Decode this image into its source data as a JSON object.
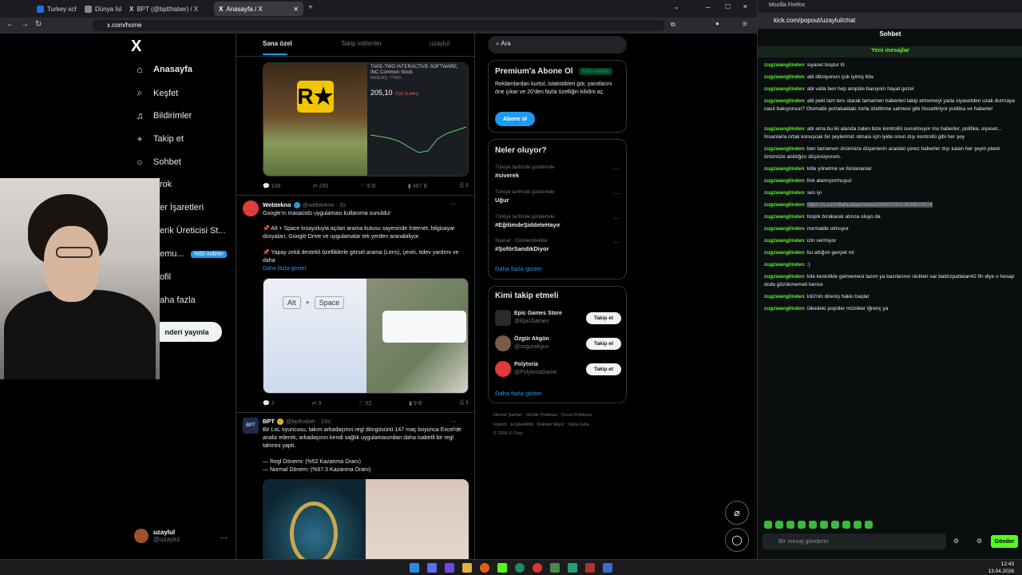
{
  "browser": {
    "tabs": [
      {
        "label": "Turkey scho"
      },
      {
        "label": "Dünya İslerı"
      },
      {
        "label": "BPT (@bptthaber) / X"
      },
      {
        "label": "Anasayfa / X"
      }
    ],
    "url": "x.com/home",
    "new_tab": "+"
  },
  "nav": {
    "items": [
      {
        "label": "Anasayfa",
        "icon": "home-icon"
      },
      {
        "label": "Keşfet",
        "icon": "search-icon"
      },
      {
        "label": "Bildirimler",
        "icon": "bell-icon"
      },
      {
        "label": "Takip et",
        "icon": "follow-icon"
      },
      {
        "label": "Sohbet",
        "icon": "chat-icon"
      },
      {
        "label": "rok",
        "icon": "grok-icon"
      },
      {
        "label": "er İşaretleri",
        "icon": "bookmark-icon"
      },
      {
        "label": "erik Üreticisi St...",
        "icon": "creator-icon"
      },
      {
        "label": "emu...",
        "icon": "premium-icon"
      },
      {
        "label": "ofil",
        "icon": "profile-icon"
      },
      {
        "label": "aha fazla",
        "icon": "more-icon"
      }
    ],
    "premium_badge": "%50 indirim",
    "post_button": "nderi yayınla",
    "me": {
      "name": "uzaylul",
      "handle": "@uzaylul"
    }
  },
  "feed": {
    "tabs": [
      "Sana özel",
      "Takip edilenler",
      "uzaylul"
    ],
    "post1": {
      "img_title": "TAKE-TWO INTERACTIVE SOFTWARE, INC Common Stock",
      "img_ticker": "NASDAQ: TTWO",
      "img_price": "205,10",
      "img_change": "-2,92 (1,44%)",
      "stats": [
        "108",
        "290",
        "6 B",
        "487 B"
      ]
    },
    "post2": {
      "name": "Webtekno",
      "handle": "@webtekno · 2s",
      "lines": [
        "Google'ın masaüstü uygulaması kullanıma sunuldu!",
        "📌 Alt + Space kısayoluyla açılan arama kutusu sayesinde İnternet, bilgisayar dosyaları, Google Drive ve uygulamalar tek yerden aranabiliyor.",
        "📌 Yapay zekâ destekli özelliklerle görsel arama (Lens), çeviri, ödev yardımı ve daha"
      ],
      "more": "Daha fazla göster",
      "keys": [
        "Alt",
        "+",
        "Space"
      ],
      "stats": [
        "3",
        "3",
        "52",
        "9 B"
      ]
    },
    "post3": {
      "name": "BPT",
      "handle": "@bpthaber · 19s",
      "lines": [
        "Bir LoL oyuncusu, takım arkadaşının regl döngüsünü 147 maç boyunca Excel'de analiz ederek, arkadaşının kendi sağlık uygulamasından daha isabetli bir regl tahmini yaptı.",
        "— Regl Dönemi: (%52 Kazanma Oranı)",
        "— Normal Dönem: (%57.5 Kazanma Oranı)"
      ]
    }
  },
  "right": {
    "search_placeholder": "Ara",
    "premium": {
      "title": "Premium'a Abone Ol",
      "badge": "%50 indirim",
      "text": "Reklamlardan kurtul, istatistikleri gör, yanıtlarını öne çıkar ve 20'den fazla özelliğin kilidini aç.",
      "button": "Abone ol"
    },
    "trends_title": "Neler oluyor?",
    "trends": [
      {
        "meta": "Türkiye tarihinde gündemde",
        "name": "#siverek"
      },
      {
        "meta": "Türkiye tarihinde gündemde",
        "name": "Uğur"
      },
      {
        "meta": "Türkiye tarihinde gündemde",
        "name": "#EğitimdeŞiddeteHayır"
      },
      {
        "meta": "Siyaset · Gündemdekiler",
        "name": "#ŞoförSandıkDiyor"
      }
    ],
    "trends_more": "Daha fazla göster",
    "follow_title": "Kimi takip etmeli",
    "follow": [
      {
        "name": "Epic Games Store",
        "handle": "@EpicGames",
        "color": "#2a2a2a"
      },
      {
        "name": "Özgür Akgün",
        "handle": "@ozgurakgun",
        "color": "#7a5b45"
      },
      {
        "name": "Polytoria",
        "handle": "@PolytoriaGame",
        "color": "#e03a3a"
      }
    ],
    "follow_button": "Takip et",
    "follow_more": "Daha fazla göster",
    "footer": [
      "Hizmet Şartları",
      "Gizlilik Politikası",
      "Çerez Politikası",
      "Imprint",
      "Erişilebilirlik",
      "Reklam bilgisi",
      "Daha fazla ...",
      "© 2026 X Corp."
    ]
  },
  "kick": {
    "window_title": "Mozilla Firefox",
    "url": "kick.com/popout/uzaylul/chat",
    "header": "Sohbet",
    "new_messages": "Yeni mesajlar",
    "messages": [
      {
        "user": "zugzwanglinden",
        "text": "siyaset boştur lö"
      },
      {
        "user": "zugzwanglinden",
        "text": "abi diksiyonun çok iyimiş btw"
      },
      {
        "user": "zugzwanglinden",
        "text": "abi valla ben hep ampüle basıyom hayat guzel"
      },
      {
        "user": "zugzwanglinden",
        "text": "abi peki tam ters olarak tamamen haberleri takip etmemeyi yada siyasetden uzak durmaya nasıl bakıyorsun? Otomatik portakaldaki zorla izlettirme sahnesi gibi hissettiriyor politika ve haberler"
      },
      {
        "user": "zugzwanglinden",
        "text": "abi ama bu iki alanda zaten bize kontrollü sunulmuyor mu haberler, politika, siyaset... İnsanlarla ortak konuşcak bir şeylerimiz olması için iyide onun dışı kontrollü gibi her şey"
      },
      {
        "user": "zugzwanglinden",
        "text": "ben tamamen önümüze düşenlerin aradaki çerez haberler dışı kalan her şeyin planlı önümüze atıldığını düşünüyorum."
      },
      {
        "user": "zugzwanglinden",
        "text": "kitle yönetme ve fonlananlar"
      },
      {
        "user": "zugzwanglinden",
        "text": "link atamıyormuşuz"
      },
      {
        "user": "zugzwanglinden",
        "text": "ses iyi"
      },
      {
        "user": "zugzwanglinden",
        "text": "",
        "link": "https://x.com/Bahcaliaa/status/1669703010638978074"
      },
      {
        "user": "zugzwanglinden",
        "text": "boşlık bırakarak atınca oluyo da"
      },
      {
        "user": "zugzwanglinden",
        "text": "normalde olmuyor"
      },
      {
        "user": "zugzwanglinden",
        "text": "izin vermiyor"
      },
      {
        "user": "zugzwanglinden",
        "text": "bu attığım gerçek mi"
      },
      {
        "user": "zugzwanglinden",
        "text": ":)"
      },
      {
        "user": "zugzwanglinden",
        "text": "lole kesinlikle gelmemesi lazım ya bazılarının nickleri var baldızpatlatan42 fln diye o hesap dcde gözükmemeli bence"
      },
      {
        "user": "zugzwanglinden",
        "text": "lolü'nin direniş hakkı başlar"
      },
      {
        "user": "zugzwanglinden",
        "text": "ülkedeki popüler müzikler iğrenç ya"
      }
    ],
    "input_placeholder": "Bir mesaj gönderin",
    "send": "Gönder"
  },
  "taskbar": {
    "time": "12:43",
    "date": "13.04.2026"
  }
}
